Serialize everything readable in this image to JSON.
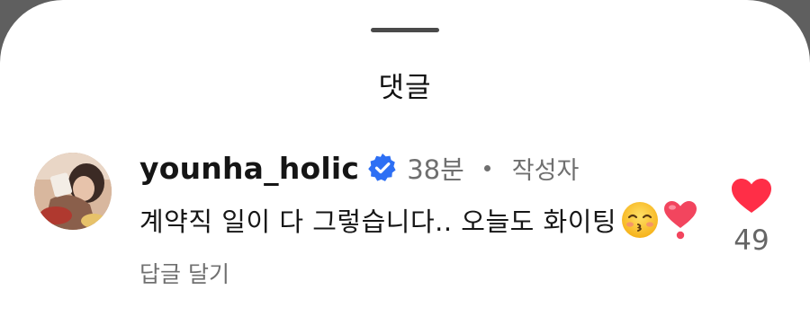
{
  "sheet": {
    "title": "댓글"
  },
  "comment": {
    "username": "younha_holic",
    "verified_icon": "verified-badge-icon",
    "time_ago": "38분",
    "author_label": "작성자",
    "text": "계약직 일이 다 그렇습니다.. 오늘도 화이팅",
    "emojis": [
      "kissing-face-closed-eyes-emoji",
      "heart-exclamation-emoji"
    ],
    "reply_label": "답글 달기",
    "likes": "49"
  },
  "colors": {
    "accent_blue": "#2d6ff4",
    "like_red": "#ff2e47",
    "muted_text": "#6f6f6f"
  }
}
